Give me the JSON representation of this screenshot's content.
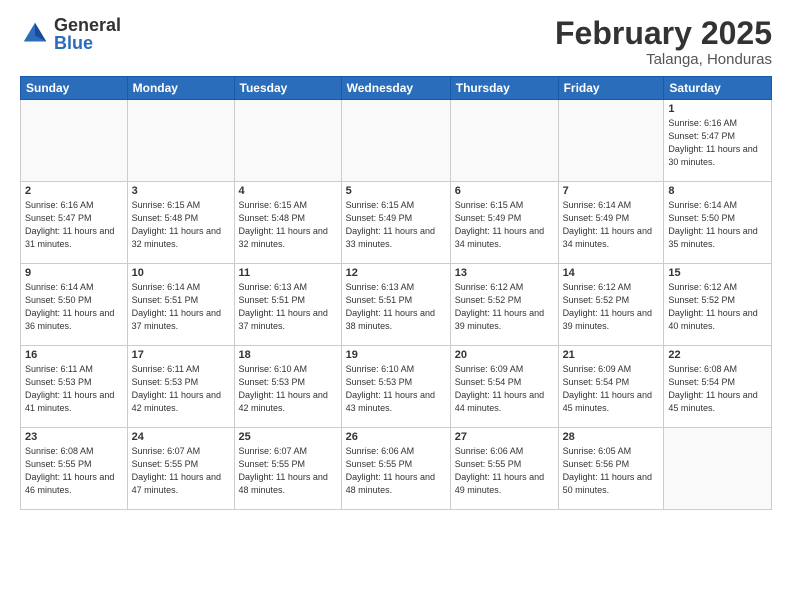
{
  "header": {
    "logo_general": "General",
    "logo_blue": "Blue",
    "month_title": "February 2025",
    "subtitle": "Talanga, Honduras"
  },
  "days_of_week": [
    "Sunday",
    "Monday",
    "Tuesday",
    "Wednesday",
    "Thursday",
    "Friday",
    "Saturday"
  ],
  "weeks": [
    [
      {
        "day": "",
        "info": ""
      },
      {
        "day": "",
        "info": ""
      },
      {
        "day": "",
        "info": ""
      },
      {
        "day": "",
        "info": ""
      },
      {
        "day": "",
        "info": ""
      },
      {
        "day": "",
        "info": ""
      },
      {
        "day": "1",
        "info": "Sunrise: 6:16 AM\nSunset: 5:47 PM\nDaylight: 11 hours\nand 30 minutes."
      }
    ],
    [
      {
        "day": "2",
        "info": "Sunrise: 6:16 AM\nSunset: 5:47 PM\nDaylight: 11 hours\nand 31 minutes."
      },
      {
        "day": "3",
        "info": "Sunrise: 6:15 AM\nSunset: 5:48 PM\nDaylight: 11 hours\nand 32 minutes."
      },
      {
        "day": "4",
        "info": "Sunrise: 6:15 AM\nSunset: 5:48 PM\nDaylight: 11 hours\nand 32 minutes."
      },
      {
        "day": "5",
        "info": "Sunrise: 6:15 AM\nSunset: 5:49 PM\nDaylight: 11 hours\nand 33 minutes."
      },
      {
        "day": "6",
        "info": "Sunrise: 6:15 AM\nSunset: 5:49 PM\nDaylight: 11 hours\nand 34 minutes."
      },
      {
        "day": "7",
        "info": "Sunrise: 6:14 AM\nSunset: 5:49 PM\nDaylight: 11 hours\nand 34 minutes."
      },
      {
        "day": "8",
        "info": "Sunrise: 6:14 AM\nSunset: 5:50 PM\nDaylight: 11 hours\nand 35 minutes."
      }
    ],
    [
      {
        "day": "9",
        "info": "Sunrise: 6:14 AM\nSunset: 5:50 PM\nDaylight: 11 hours\nand 36 minutes."
      },
      {
        "day": "10",
        "info": "Sunrise: 6:14 AM\nSunset: 5:51 PM\nDaylight: 11 hours\nand 37 minutes."
      },
      {
        "day": "11",
        "info": "Sunrise: 6:13 AM\nSunset: 5:51 PM\nDaylight: 11 hours\nand 37 minutes."
      },
      {
        "day": "12",
        "info": "Sunrise: 6:13 AM\nSunset: 5:51 PM\nDaylight: 11 hours\nand 38 minutes."
      },
      {
        "day": "13",
        "info": "Sunrise: 6:12 AM\nSunset: 5:52 PM\nDaylight: 11 hours\nand 39 minutes."
      },
      {
        "day": "14",
        "info": "Sunrise: 6:12 AM\nSunset: 5:52 PM\nDaylight: 11 hours\nand 39 minutes."
      },
      {
        "day": "15",
        "info": "Sunrise: 6:12 AM\nSunset: 5:52 PM\nDaylight: 11 hours\nand 40 minutes."
      }
    ],
    [
      {
        "day": "16",
        "info": "Sunrise: 6:11 AM\nSunset: 5:53 PM\nDaylight: 11 hours\nand 41 minutes."
      },
      {
        "day": "17",
        "info": "Sunrise: 6:11 AM\nSunset: 5:53 PM\nDaylight: 11 hours\nand 42 minutes."
      },
      {
        "day": "18",
        "info": "Sunrise: 6:10 AM\nSunset: 5:53 PM\nDaylight: 11 hours\nand 42 minutes."
      },
      {
        "day": "19",
        "info": "Sunrise: 6:10 AM\nSunset: 5:53 PM\nDaylight: 11 hours\nand 43 minutes."
      },
      {
        "day": "20",
        "info": "Sunrise: 6:09 AM\nSunset: 5:54 PM\nDaylight: 11 hours\nand 44 minutes."
      },
      {
        "day": "21",
        "info": "Sunrise: 6:09 AM\nSunset: 5:54 PM\nDaylight: 11 hours\nand 45 minutes."
      },
      {
        "day": "22",
        "info": "Sunrise: 6:08 AM\nSunset: 5:54 PM\nDaylight: 11 hours\nand 45 minutes."
      }
    ],
    [
      {
        "day": "23",
        "info": "Sunrise: 6:08 AM\nSunset: 5:55 PM\nDaylight: 11 hours\nand 46 minutes."
      },
      {
        "day": "24",
        "info": "Sunrise: 6:07 AM\nSunset: 5:55 PM\nDaylight: 11 hours\nand 47 minutes."
      },
      {
        "day": "25",
        "info": "Sunrise: 6:07 AM\nSunset: 5:55 PM\nDaylight: 11 hours\nand 48 minutes."
      },
      {
        "day": "26",
        "info": "Sunrise: 6:06 AM\nSunset: 5:55 PM\nDaylight: 11 hours\nand 48 minutes."
      },
      {
        "day": "27",
        "info": "Sunrise: 6:06 AM\nSunset: 5:55 PM\nDaylight: 11 hours\nand 49 minutes."
      },
      {
        "day": "28",
        "info": "Sunrise: 6:05 AM\nSunset: 5:56 PM\nDaylight: 11 hours\nand 50 minutes."
      },
      {
        "day": "",
        "info": ""
      }
    ]
  ]
}
